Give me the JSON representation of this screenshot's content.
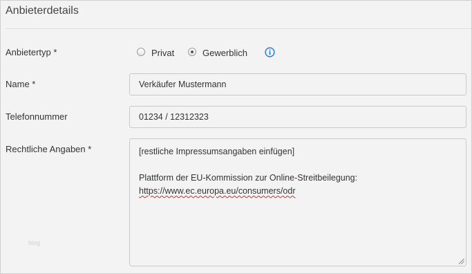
{
  "section": {
    "title": "Anbieterdetails"
  },
  "form": {
    "anbietertyp": {
      "label": "Anbietertyp *",
      "options": [
        {
          "label": "Privat",
          "checked": false
        },
        {
          "label": "Gewerblich",
          "checked": true
        }
      ],
      "info_icon": "info-circle-icon"
    },
    "name": {
      "label": "Name *",
      "value": "Verkäufer Mustermann"
    },
    "telefon": {
      "label": "Telefonnummer",
      "value": "01234 / 12312323"
    },
    "rechtliche": {
      "label": "Rechtliche Angaben *",
      "line1": "[restliche Impressumsangaben einfügen]",
      "line2": "Plattform der EU-Kommission zur Online-Streitbeilegung:",
      "line3": "https://www.ec.europa.eu/consumers/odr"
    }
  },
  "watermark": "blog",
  "colors": {
    "info_icon": "#2a7bd1",
    "spellcheck": "#d42a2a"
  }
}
